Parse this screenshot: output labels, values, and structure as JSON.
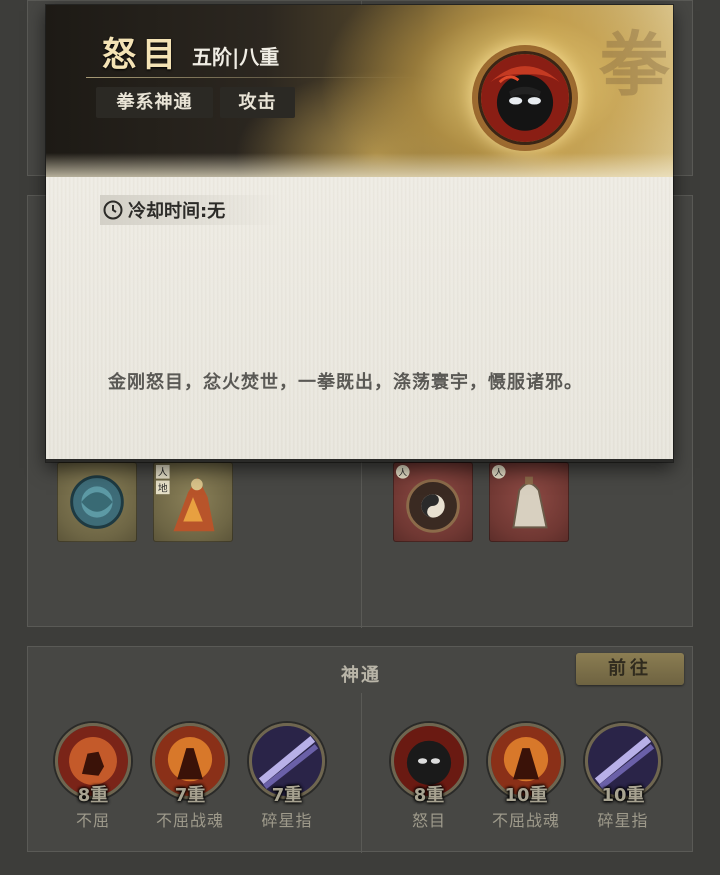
{
  "popup": {
    "skill_name": "怒目",
    "rank": "五阶|八重",
    "tags": [
      "拳系神通",
      "攻击"
    ],
    "watermark": "拳",
    "cooldown_label": "冷却时间:无",
    "description": "金刚怒目，忿火焚世，一拳既出，涤荡寰宇，慑服诸邪。"
  },
  "skills_panel": {
    "title": "神通",
    "goto_label": "前往",
    "left": [
      {
        "tier": "8重",
        "name": "不屈"
      },
      {
        "tier": "7重",
        "name": "不屈战魂"
      },
      {
        "tier": "7重",
        "name": "碎星指"
      }
    ],
    "right": [
      {
        "tier": "8重",
        "name": "怒目"
      },
      {
        "tier": "10重",
        "name": "不屈战魂"
      },
      {
        "tier": "10重",
        "name": "碎星指"
      }
    ]
  },
  "item_badges": {
    "ren": "人",
    "di": "地"
  },
  "colors": {
    "accent_gold": "#f4e3b5",
    "panel_bg": "#474744",
    "popup_body": "#ece9e0"
  }
}
